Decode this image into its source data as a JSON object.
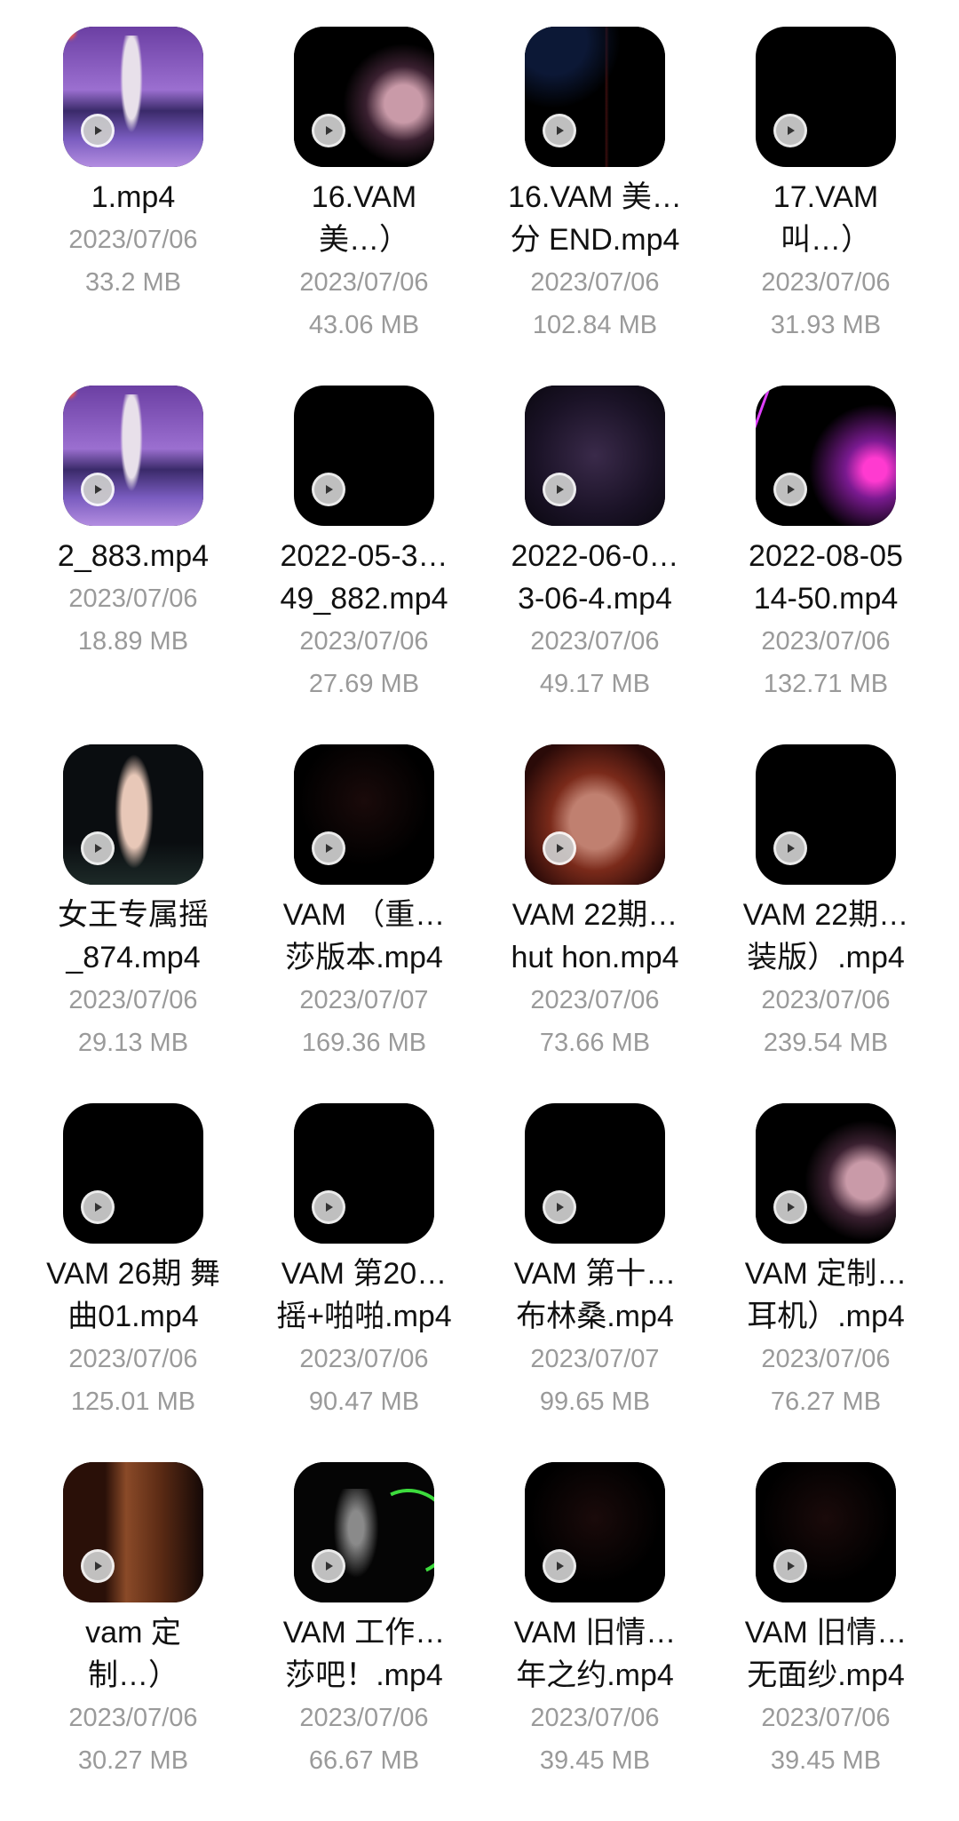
{
  "files": [
    {
      "name_line1": "1.mp4",
      "name_line2": "",
      "date": "2023/07/06",
      "size": "33.2 MB",
      "thumb": "purple-lake"
    },
    {
      "name_line1": "16.VAM",
      "name_line2": "美…）",
      "date": "2023/07/06",
      "size": "43.06 MB",
      "thumb": "dark-figure"
    },
    {
      "name_line1": "16.VAM 美…",
      "name_line2": "分 END.mp4",
      "date": "2023/07/06",
      "size": "102.84 MB",
      "thumb": "dark-line"
    },
    {
      "name_line1": "17.VAM",
      "name_line2": "叫…）",
      "date": "2023/07/06",
      "size": "31.93 MB",
      "thumb": "black"
    },
    {
      "name_line1": "2_883.mp4",
      "name_line2": "",
      "date": "2023/07/06",
      "size": "18.89 MB",
      "thumb": "purple-lake"
    },
    {
      "name_line1": "2022-05-3…",
      "name_line2": "49_882.mp4",
      "date": "2023/07/06",
      "size": "27.69 MB",
      "thumb": "black"
    },
    {
      "name_line1": "2022-06-0…",
      "name_line2": "3-06-4.mp4",
      "date": "2023/07/06",
      "size": "49.17 MB",
      "thumb": "starfield"
    },
    {
      "name_line1": "2022-08-05",
      "name_line2": "14-50.mp4",
      "date": "2023/07/06",
      "size": "132.71 MB",
      "thumb": "neon"
    },
    {
      "name_line1": "女王专属摇",
      "name_line2": "_874.mp4",
      "date": "2023/07/06",
      "size": "29.13 MB",
      "thumb": "night-figure"
    },
    {
      "name_line1": "VAM （重…",
      "name_line2": "莎版本.mp4",
      "date": "2023/07/07",
      "size": "169.36 MB",
      "thumb": "faint"
    },
    {
      "name_line1": "VAM 22期…",
      "name_line2": "hut hon.mp4",
      "date": "2023/07/06",
      "size": "73.66 MB",
      "thumb": "red-dancer"
    },
    {
      "name_line1": "VAM 22期…",
      "name_line2": "装版）.mp4",
      "date": "2023/07/06",
      "size": "239.54 MB",
      "thumb": "black"
    },
    {
      "name_line1": "VAM 26期 舞",
      "name_line2": "曲01.mp4",
      "date": "2023/07/06",
      "size": "125.01 MB",
      "thumb": "black"
    },
    {
      "name_line1": "VAM 第20…",
      "name_line2": "摇+啪啪.mp4",
      "date": "2023/07/06",
      "size": "90.47 MB",
      "thumb": "watermark"
    },
    {
      "name_line1": "VAM 第十…",
      "name_line2": "布林桑.mp4",
      "date": "2023/07/07",
      "size": "99.65 MB",
      "thumb": "black"
    },
    {
      "name_line1": "VAM 定制…",
      "name_line2": "耳机）.mp4",
      "date": "2023/07/06",
      "size": "76.27 MB",
      "thumb": "dark-figure"
    },
    {
      "name_line1": "vam 定",
      "name_line2": "制…）",
      "date": "2023/07/06",
      "size": "30.27 MB",
      "thumb": "warm-room"
    },
    {
      "name_line1": "VAM 工作…",
      "name_line2": "莎吧！.mp4",
      "date": "2023/07/06",
      "size": "66.67 MB",
      "thumb": "green-arc"
    },
    {
      "name_line1": "VAM 旧情…",
      "name_line2": "年之约.mp4",
      "date": "2023/07/06",
      "size": "39.45 MB",
      "thumb": "faint"
    },
    {
      "name_line1": "VAM 旧情…",
      "name_line2": "无面纱.mp4",
      "date": "2023/07/06",
      "size": "39.45 MB",
      "thumb": "faint"
    }
  ],
  "icons": {
    "play": "play-icon"
  }
}
